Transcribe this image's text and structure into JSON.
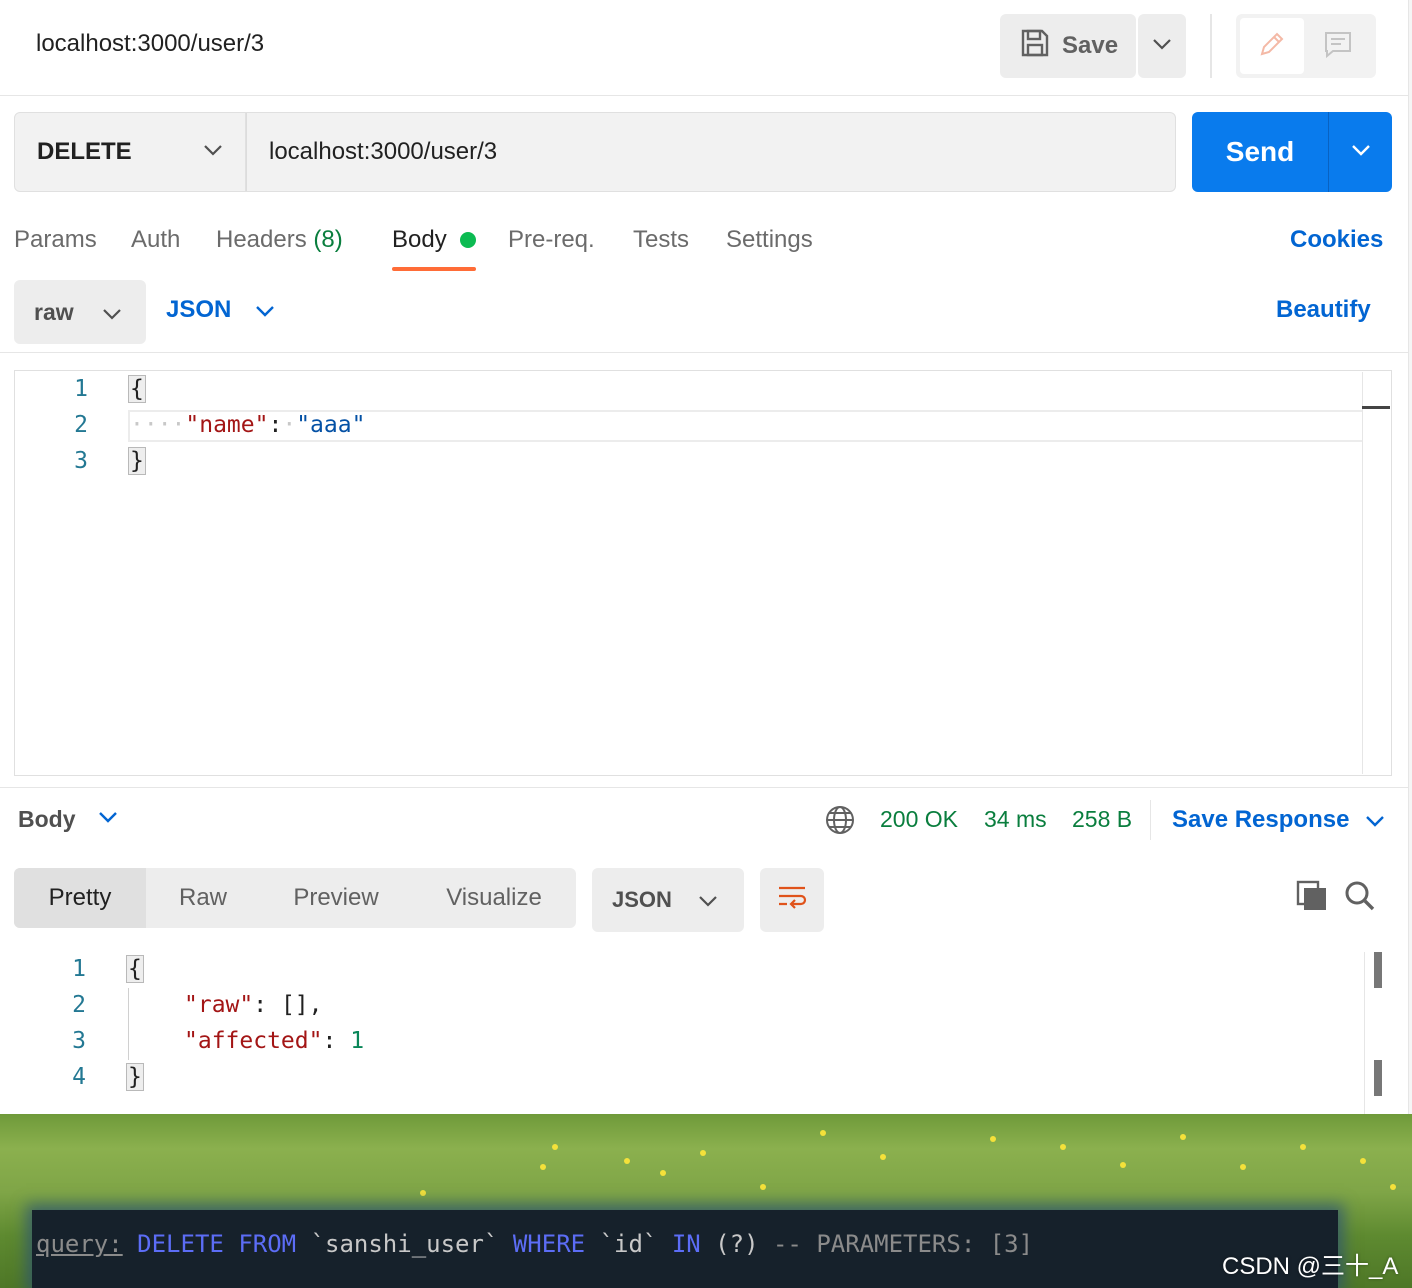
{
  "header": {
    "title": "localhost:3000/user/3",
    "save_label": "Save"
  },
  "request": {
    "method": "DELETE",
    "url": "localhost:3000/user/3",
    "send_label": "Send",
    "tabs": {
      "params": "Params",
      "auth": "Auth",
      "headers": "Headers",
      "headers_count": "(8)",
      "body": "Body",
      "prereq": "Pre-req.",
      "tests": "Tests",
      "settings": "Settings"
    },
    "cookies_label": "Cookies",
    "body_mode": "raw",
    "body_language": "JSON",
    "beautify_label": "Beautify",
    "body_lines": [
      {
        "n": "1",
        "open": "{"
      },
      {
        "n": "2",
        "ws": "····",
        "key": "\"name\"",
        "colon": ":",
        "ws2": "·",
        "value": "\"aaa\""
      },
      {
        "n": "3",
        "close": "}"
      }
    ]
  },
  "response": {
    "section_label": "Body",
    "status": "200 OK",
    "time": "34 ms",
    "size": "258 B",
    "save_response_label": "Save Response",
    "view_tabs": [
      "Pretty",
      "Raw",
      "Preview",
      "Visualize"
    ],
    "active_view": "Pretty",
    "format": "JSON",
    "lines": [
      {
        "n": "1",
        "open": "{"
      },
      {
        "n": "2",
        "key": "\"raw\"",
        "rest": ": [],"
      },
      {
        "n": "3",
        "key": "\"affected\"",
        "colon": ": ",
        "num": "1"
      },
      {
        "n": "4",
        "close": "}"
      }
    ]
  },
  "terminal": {
    "prefix": "query:",
    "kw_delete": "DELETE",
    "kw_from": "FROM",
    "table": "`sanshi_user`",
    "kw_where": "WHERE",
    "column": "`id`",
    "kw_in": "IN",
    "params": "(?)",
    "comment": "-- PARAMETERS: [3]"
  },
  "watermark": "CSDN @三十_A",
  "icons": {
    "save": "floppy-disk-icon",
    "dropdown": "chevron-down-icon",
    "edit": "pencil-icon",
    "comment": "comment-icon",
    "globe": "globe-icon",
    "wrap": "wrap-lines-icon",
    "copy": "copy-icon",
    "search": "search-icon"
  },
  "colors": {
    "accent_blue": "#097bed",
    "link_blue": "#0265d2",
    "status_green": "#0a7e3e",
    "tab_underline": "#ff6c37",
    "body_dot": "#0cbb52"
  }
}
